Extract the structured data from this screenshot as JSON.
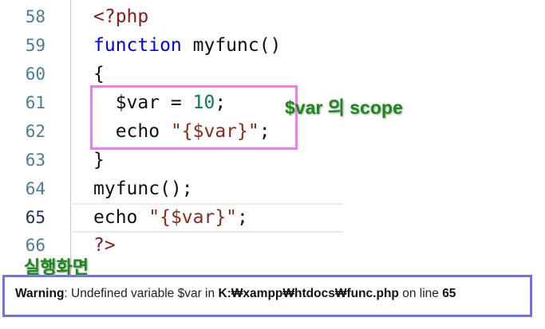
{
  "editor": {
    "active_line": "65",
    "lines": [
      {
        "num": "58",
        "parts": [
          "<?php"
        ]
      },
      {
        "num": "59",
        "parts": [
          "function",
          " myfunc()"
        ]
      },
      {
        "num": "60",
        "parts": [
          "{"
        ]
      },
      {
        "num": "61",
        "parts": [
          "  $var = ",
          "10",
          ";"
        ]
      },
      {
        "num": "62",
        "parts": [
          "  echo ",
          "\"{$var}\"",
          ";"
        ]
      },
      {
        "num": "63",
        "parts": [
          "}"
        ]
      },
      {
        "num": "64",
        "parts": [
          "myfunc();"
        ]
      },
      {
        "num": "65",
        "parts": [
          "echo ",
          "\"{$var}\"",
          ";"
        ]
      },
      {
        "num": "66",
        "parts": [
          "?>"
        ]
      }
    ]
  },
  "annotations": {
    "scope_label": "$var 의 scope",
    "run_label": "실행화면",
    "scope_box_color": "#f27af0",
    "output_box_color": "#7272ee",
    "label_color": "#1a8a1a"
  },
  "output": {
    "warning_label": "Warning",
    "message_1": ": Undefined variable $var in ",
    "file_path": "K:₩xampp₩htdocs₩func.php",
    "message_2": " on line ",
    "line_number": "65"
  }
}
